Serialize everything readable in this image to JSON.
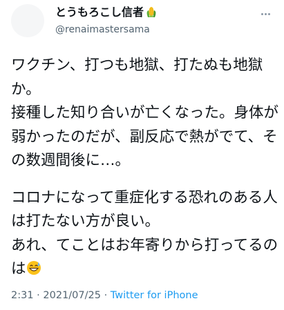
{
  "tweet": {
    "author": {
      "display_name": "とうもろこし信者",
      "name_emoji_icon": "corn-icon",
      "handle": "@renaimastersama"
    },
    "more_icon": "more-icon",
    "paragraphs": [
      "ワクチン、打つも地獄、打たぬも地獄か。\n接種した知り合いが亡くなった。身体が弱かったのだが、副反応で熱がでて、その数週間後に…。",
      "コロナになって重症化する恐れのある人は打たない方が良い。\nあれ、てことはお年寄りから打ってるのは"
    ],
    "trailing_emoji_icon": "grinning-sweat-icon",
    "meta": {
      "time": "2:31",
      "separator_1": " · ",
      "date": "2021/07/25",
      "separator_2": " · ",
      "source": "Twitter for iPhone"
    },
    "colors": {
      "text": "#0f1419",
      "secondary": "#536471",
      "link": "#1d9bf0"
    }
  }
}
